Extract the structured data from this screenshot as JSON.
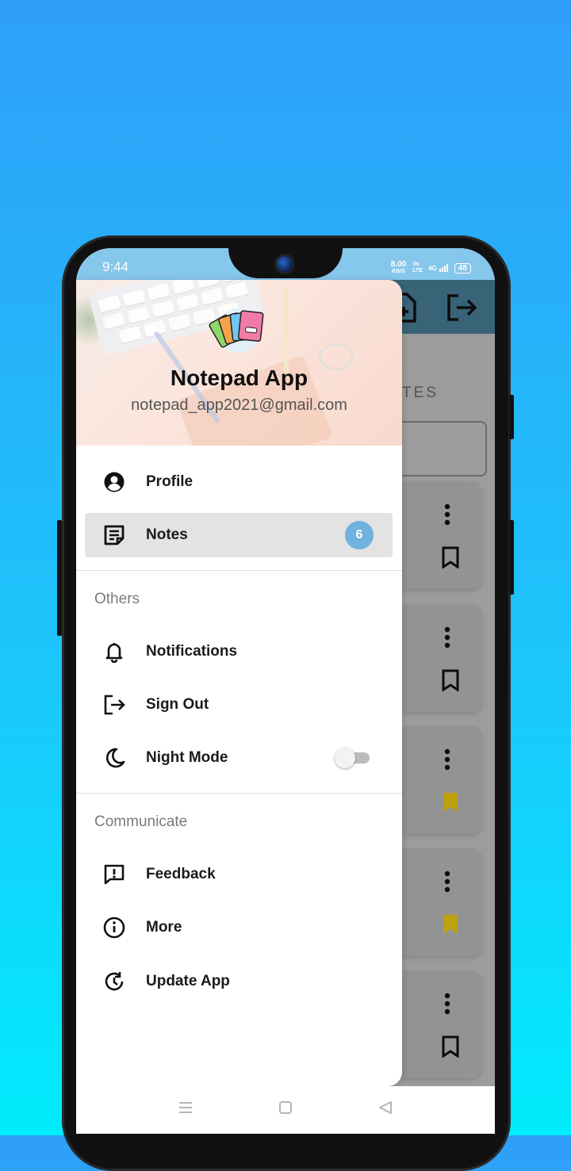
{
  "status_bar": {
    "time": "9:44",
    "net_speed": "8.00",
    "net_unit": "KB/S",
    "volte": "Vo LTE",
    "signal": "4G",
    "battery": "48"
  },
  "background_app": {
    "heading_partial": "TES",
    "toolbar_color": "#4a7f99",
    "bookmark_colors": [
      "#1b1b1b",
      "#1b1b1b",
      "#f2cf14",
      "#f2cf14",
      "#1b1b1b"
    ],
    "icons": [
      "add-note-icon",
      "logout-icon",
      "more-vert-icon",
      "bookmark-icon"
    ]
  },
  "drawer": {
    "header": {
      "title": "Notepad App",
      "email": "notepad_app2021@gmail.com"
    },
    "primary_items": [
      {
        "label": "Profile",
        "icon": "account-circle-icon"
      },
      {
        "label": "Notes",
        "icon": "notes-icon",
        "badge": "6",
        "active": true
      }
    ],
    "others_section": {
      "title": "Others",
      "items": [
        {
          "label": "Notifications",
          "icon": "bell-icon"
        },
        {
          "label": "Sign Out",
          "icon": "sign-out-icon"
        },
        {
          "label": "Night Mode",
          "icon": "moon-icon",
          "toggle_on": false
        }
      ]
    },
    "communicate_section": {
      "title": "Communicate",
      "items": [
        {
          "label": "Feedback",
          "icon": "feedback-icon"
        },
        {
          "label": "More",
          "icon": "info-icon"
        },
        {
          "label": "Update App",
          "icon": "update-icon"
        }
      ]
    }
  },
  "colors": {
    "badge": "#6fb2de",
    "active_item_bg": "#e3e3e3",
    "status_bar": "#86c7ec",
    "bookmark_active": "#f2cf14"
  }
}
